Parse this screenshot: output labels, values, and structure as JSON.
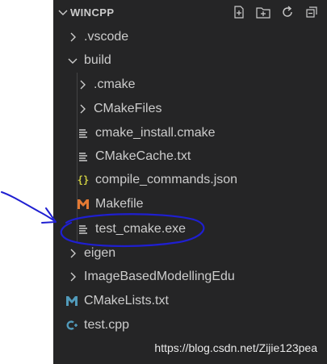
{
  "explorer": {
    "title": "WINCPP",
    "title_chevron_icon": "chevron-down-icon",
    "actions": [
      {
        "name": "new-file-button",
        "icon": "new-file-icon"
      },
      {
        "name": "new-folder-button",
        "icon": "new-folder-icon"
      },
      {
        "name": "refresh-button",
        "icon": "refresh-icon"
      },
      {
        "name": "collapse-all-button",
        "icon": "collapse-all-icon"
      }
    ],
    "tree": [
      {
        "label": ".vscode",
        "type": "folder",
        "expanded": false,
        "depth": 1
      },
      {
        "label": "build",
        "type": "folder",
        "expanded": true,
        "depth": 1
      },
      {
        "label": ".cmake",
        "type": "folder",
        "expanded": false,
        "depth": 2
      },
      {
        "label": "CMakeFiles",
        "type": "folder",
        "expanded": false,
        "depth": 2
      },
      {
        "label": "cmake_install.cmake",
        "type": "file",
        "icon": "text-file-icon",
        "depth": 2
      },
      {
        "label": "CMakeCache.txt",
        "type": "file",
        "icon": "text-file-icon",
        "depth": 2
      },
      {
        "label": "compile_commands.json",
        "type": "file",
        "icon": "json-braces-icon",
        "depth": 2
      },
      {
        "label": "Makefile",
        "type": "file",
        "icon": "makefile-m-icon",
        "depth": 2
      },
      {
        "label": "test_cmake.exe",
        "type": "file",
        "icon": "text-file-icon",
        "depth": 2
      },
      {
        "label": "eigen",
        "type": "folder",
        "expanded": false,
        "depth": 1
      },
      {
        "label": "ImageBasedModellingEdu",
        "type": "folder",
        "expanded": false,
        "depth": 1
      },
      {
        "label": "CMakeLists.txt",
        "type": "file",
        "icon": "cmake-m-icon",
        "depth": 1
      },
      {
        "label": "test.cpp",
        "type": "file",
        "icon": "cpp-file-icon",
        "depth": 1
      }
    ]
  },
  "watermark": "https://blog.csdn.net/Zijie123pea",
  "colors": {
    "background": "#252526",
    "text": "#cccccc",
    "selected_row": "#37373d",
    "annotation": "#1f1fd1",
    "makefile_icon": "#e37933",
    "json_icon": "#cbcb41",
    "cmake_icon": "#519aba",
    "cpp_icon": "#519aba"
  }
}
